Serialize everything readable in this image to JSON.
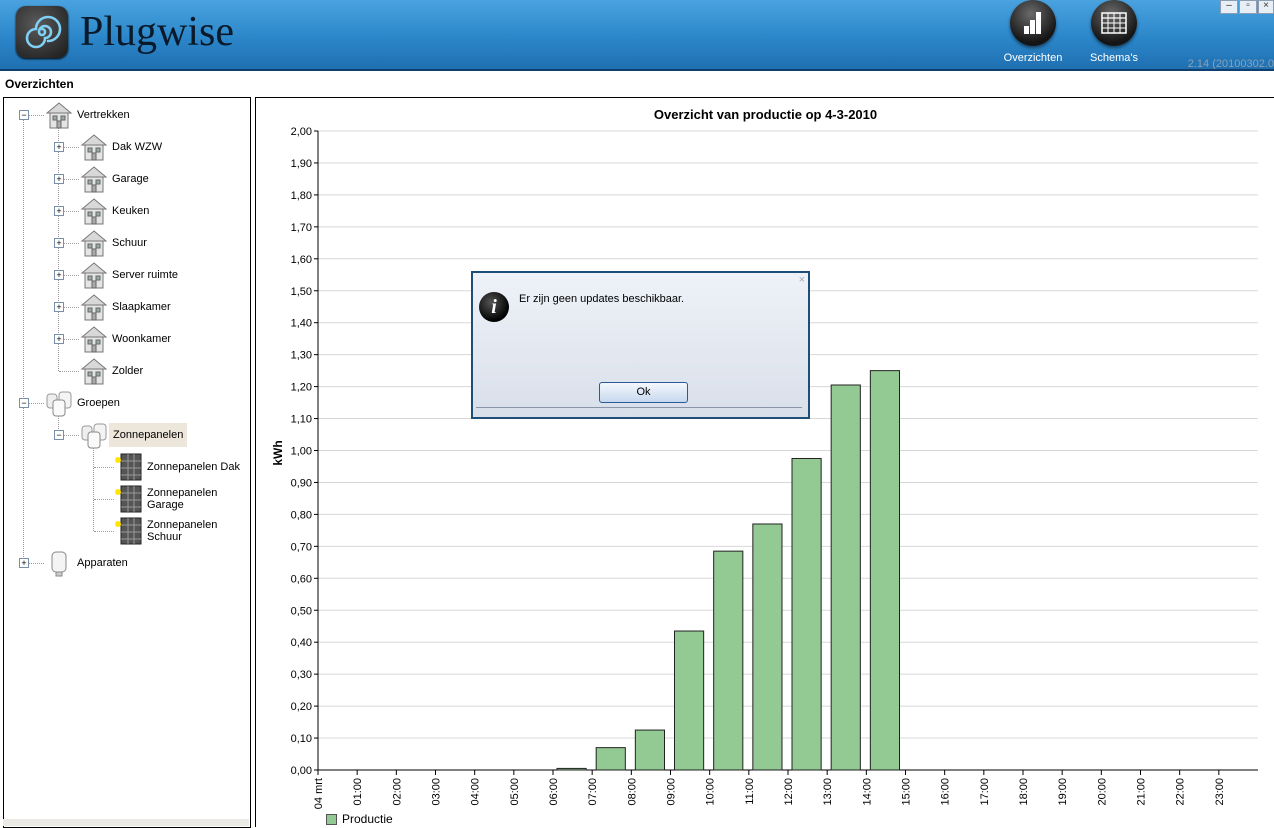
{
  "app": {
    "name": "Plugwise",
    "version": "2.14 (20100302.0"
  },
  "toolbar": {
    "overzichten_label": "Overzichten",
    "schemas_label": "Schema's"
  },
  "page": {
    "title": "Overzichten"
  },
  "tree": {
    "items": [
      {
        "label": "Vertrekken",
        "level": 0,
        "expander": "−",
        "icon": "house-icon"
      },
      {
        "label": "Dak WZW",
        "level": 1,
        "expander": "+",
        "icon": "house-icon"
      },
      {
        "label": "Garage",
        "level": 1,
        "expander": "+",
        "icon": "house-icon"
      },
      {
        "label": "Keuken",
        "level": 1,
        "expander": "+",
        "icon": "house-icon"
      },
      {
        "label": "Schuur",
        "level": 1,
        "expander": "+",
        "icon": "house-icon"
      },
      {
        "label": "Server ruimte",
        "level": 1,
        "expander": "+",
        "icon": "house-icon"
      },
      {
        "label": "Slaapkamer",
        "level": 1,
        "expander": "+",
        "icon": "house-icon"
      },
      {
        "label": "Woonkamer",
        "level": 1,
        "expander": "+",
        "icon": "house-icon"
      },
      {
        "label": "Zolder",
        "level": 1,
        "expander": "",
        "icon": "house-icon"
      },
      {
        "label": "Groepen",
        "level": 0,
        "expander": "−",
        "icon": "plugs-group-icon"
      },
      {
        "label": "Zonnepanelen",
        "level": 1,
        "expander": "−",
        "icon": "plugs-group-icon",
        "selected": true
      },
      {
        "label": "Zonnepanelen Dak",
        "level": 2,
        "expander": "",
        "icon": "solar-panel-icon"
      },
      {
        "label": "Zonnepanelen Garage",
        "level": 2,
        "expander": "",
        "icon": "solar-panel-icon"
      },
      {
        "label": "Zonnepanelen Schuur",
        "level": 2,
        "expander": "",
        "icon": "solar-panel-icon"
      },
      {
        "label": "Apparaten",
        "level": 0,
        "expander": "+",
        "icon": "plug-icon"
      }
    ]
  },
  "dialog": {
    "message": "Er zijn geen updates beschikbaar.",
    "ok_label": "Ok",
    "close_glyph": "×",
    "info_glyph": "i"
  },
  "colors": {
    "bar_fill": "#93c993",
    "header": "#2b86c9"
  },
  "chart_data": {
    "type": "bar",
    "title": "Overzicht van productie op 4-3-2010",
    "ylabel": "kWh",
    "xlabel": "",
    "ylim": [
      0,
      2.0
    ],
    "grid": true,
    "legend_position": "bottom-left",
    "categories": [
      "04 mrt",
      "01:00",
      "02:00",
      "03:00",
      "04:00",
      "05:00",
      "06:00",
      "07:00",
      "08:00",
      "09:00",
      "10:00",
      "11:00",
      "12:00",
      "13:00",
      "14:00",
      "15:00",
      "16:00",
      "17:00",
      "18:00",
      "19:00",
      "20:00",
      "21:00",
      "22:00",
      "23:00"
    ],
    "y_tick_labels": [
      "0,00",
      "0,10",
      "0,20",
      "0,30",
      "0,40",
      "0,50",
      "0,60",
      "0,70",
      "0,80",
      "0,90",
      "1,00",
      "1,10",
      "1,20",
      "1,30",
      "1,40",
      "1,50",
      "1,60",
      "1,70",
      "1,80",
      "1,90",
      "2,00"
    ],
    "series": [
      {
        "name": "Productie",
        "values": [
          0,
          0,
          0,
          0,
          0,
          0,
          0.005,
          0.07,
          0.125,
          0.435,
          0.685,
          0.77,
          0.975,
          1.205,
          1.25,
          0,
          0,
          0,
          0,
          0,
          0,
          0,
          0,
          0
        ]
      }
    ]
  }
}
